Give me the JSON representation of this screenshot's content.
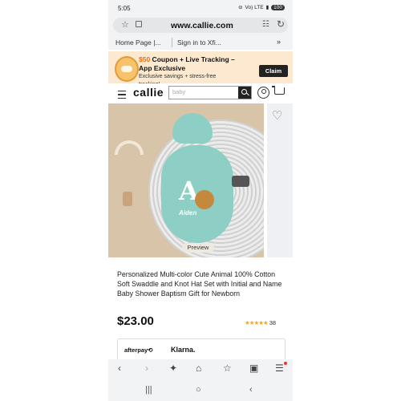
{
  "status": {
    "time": "5:05",
    "battery": "100",
    "signal": "Vo) LTE"
  },
  "browser": {
    "url": "www.callie.com",
    "bookmarks": [
      "Home Page |...",
      "Sign in to Xfi..."
    ],
    "more": "»"
  },
  "promo": {
    "amount": "$50",
    "headline_rest": " Coupon + Live Tracking –",
    "headline2": "App Exclusive",
    "subtext": "Exclusive savings + stress-free tracking!",
    "claim_label": "Claim"
  },
  "site": {
    "logo": "callie",
    "search_placeholder": "baby"
  },
  "product": {
    "image_name": "Aiden",
    "image_letter": "A",
    "preview_label": "Preview",
    "title": "Personalized Multi-color Cute Animal 100% Cotton Soft Swaddle and Knot Hat Set with Initial and Name Baby Shower Baptism Gift for Newborn",
    "price": "$23.00",
    "stars": "★★★★★",
    "review_count": "38",
    "rating": 5
  },
  "payments": {
    "afterpay": "afterpay⟲",
    "klarna": "Klarna."
  },
  "colors": {
    "promo_bg": "#fce9cf",
    "promo_amount": "#ff6a00",
    "star": "#f5a623",
    "swaddle": "#8ecfc5"
  }
}
